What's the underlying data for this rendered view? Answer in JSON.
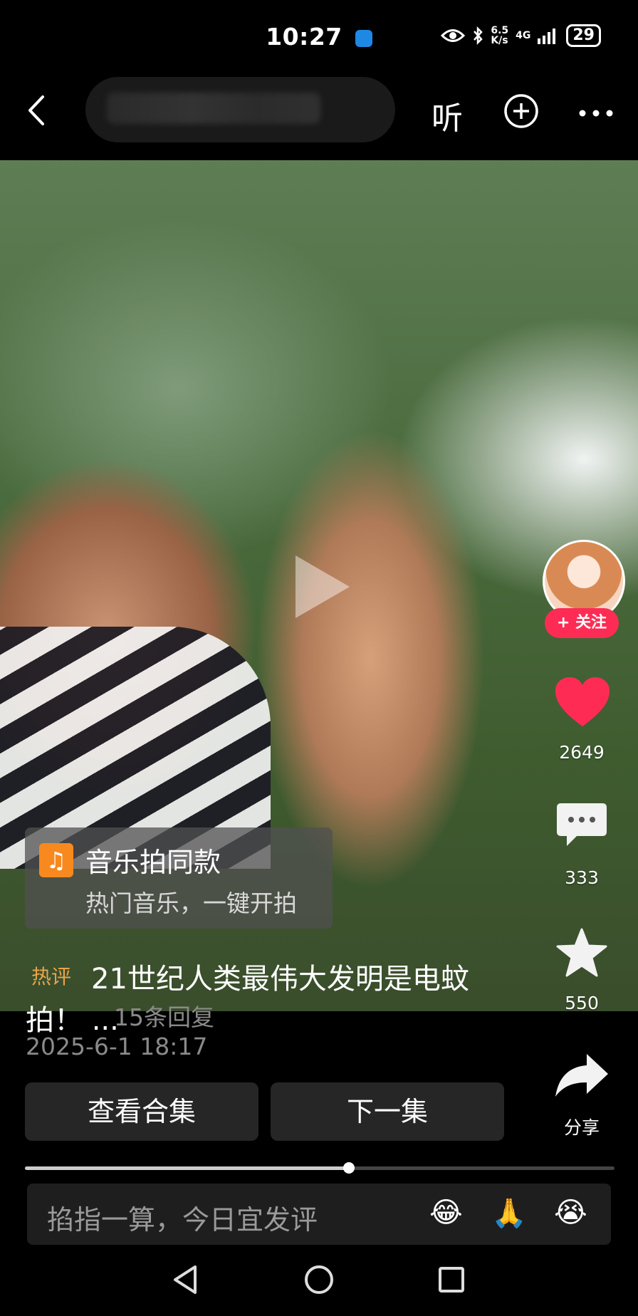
{
  "status": {
    "time": "10:27",
    "speed_top": "6.5",
    "speed_unit": "K/s",
    "network": "4G",
    "battery": "29"
  },
  "topbar": {
    "listen": "听"
  },
  "video": {},
  "rail": {
    "follow": "+ 关注",
    "likes": "2649",
    "comments": "333",
    "favorites": "550",
    "share": "分享"
  },
  "music": {
    "title": "音乐拍同款",
    "subtitle": "热门音乐，一键开拍"
  },
  "comment": {
    "tag": "热评",
    "text_line1": "21世纪人类最伟大发明是电蚊",
    "text_line2": "拍！ ...",
    "replies": "15条回复",
    "date": "2025-6-1 18:17"
  },
  "buttons": {
    "collection": "查看合集",
    "next": "下一集"
  },
  "progress": {
    "fraction": 0.55
  },
  "input": {
    "placeholder": "掐指一算，今日宜发评",
    "emoji1": "😂",
    "emoji2": "🙏",
    "emoji3": "😭"
  },
  "colors": {
    "accent": "#fe2c55",
    "like": "#fe2c55",
    "tag": "#e8a54b"
  }
}
